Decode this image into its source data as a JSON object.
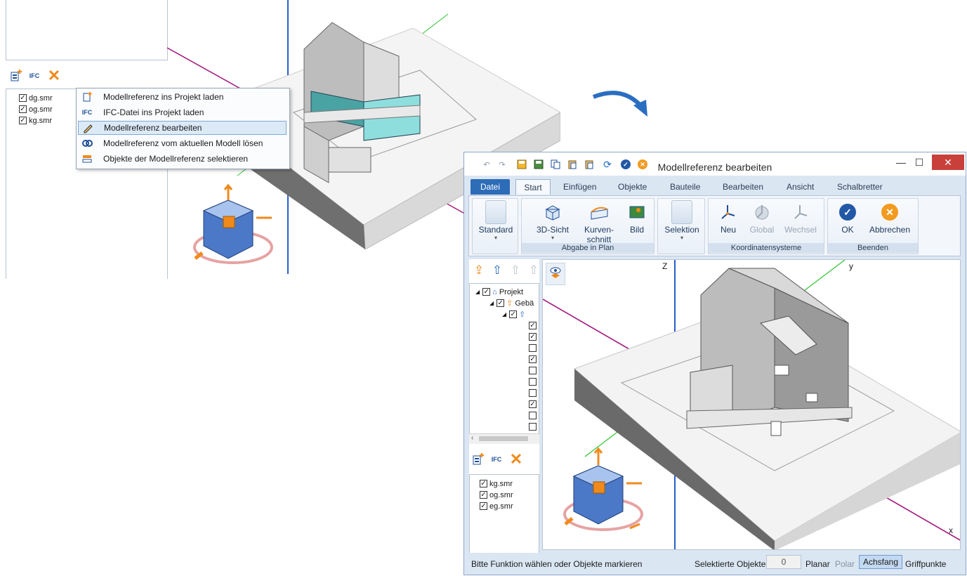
{
  "left_screenshot": {
    "toolbar": {
      "ifc_label": "IFC"
    },
    "tree": [
      "dg.smr",
      "og.smr",
      "kg.smr"
    ],
    "context_menu": [
      {
        "label": "Modellreferenz ins Projekt laden",
        "icon": "model-load-icon"
      },
      {
        "label": "IFC-Datei ins Projekt laden",
        "icon": "ifc-load-icon"
      },
      {
        "label": "Modellreferenz bearbeiten",
        "icon": "pencil-icon",
        "highlighted": true
      },
      {
        "label": "Modellreferenz vom aktuellen Modell lösen",
        "icon": "unlink-icon"
      },
      {
        "label": "Objekte der Modellreferenz selektieren",
        "icon": "select-objects-icon"
      }
    ]
  },
  "window": {
    "title": "Modellreferenz bearbeiten",
    "tabs": [
      "Datei",
      "Start",
      "Einfügen",
      "Objekte",
      "Bauteile",
      "Bearbeiten",
      "Ansicht",
      "Schalbretter"
    ],
    "active_tab": "Start",
    "ribbon": {
      "standard": "Standard",
      "view3d": "3D-Sicht",
      "kurven1": "Kurven-",
      "kurven2": "schnitt",
      "bild": "Bild",
      "group_abgabe": "Abgabe in Plan",
      "selektion": "Selektion",
      "neu": "Neu",
      "global": "Global",
      "wechsel": "Wechsel",
      "group_koord": "Koordinatensysteme",
      "ok": "OK",
      "abbrechen": "Abbrechen",
      "group_beenden": "Beenden"
    },
    "tree": {
      "projekt": "Projekt",
      "gebaeude": "Gebä",
      "ifc_label": "IFC",
      "children_checked": [
        true,
        true,
        false,
        true,
        false,
        false,
        false,
        true,
        false,
        false
      ]
    },
    "model_files": [
      "kg.smr",
      "og.smr",
      "eg.smr"
    ],
    "viewport": {
      "axis_z": "Z",
      "axis_y": "y",
      "axis_x": "x"
    },
    "status": {
      "message": "Bitte Funktion wählen oder Objekte markieren",
      "selected_label": "Selektierte Objekte",
      "selected_count": "0",
      "planar": "Planar",
      "polar": "Polar",
      "achsfang": "Achsfang",
      "griffpunkte": "Griffpunkte"
    }
  },
  "colors": {
    "accent": "#2d6cb7",
    "highlight": "#dce9f7",
    "axis_green": "#2fc22f",
    "axis_magenta": "#a3187c",
    "axis_blue": "#2a5fc7",
    "cube_orange": "#f08a1c"
  }
}
